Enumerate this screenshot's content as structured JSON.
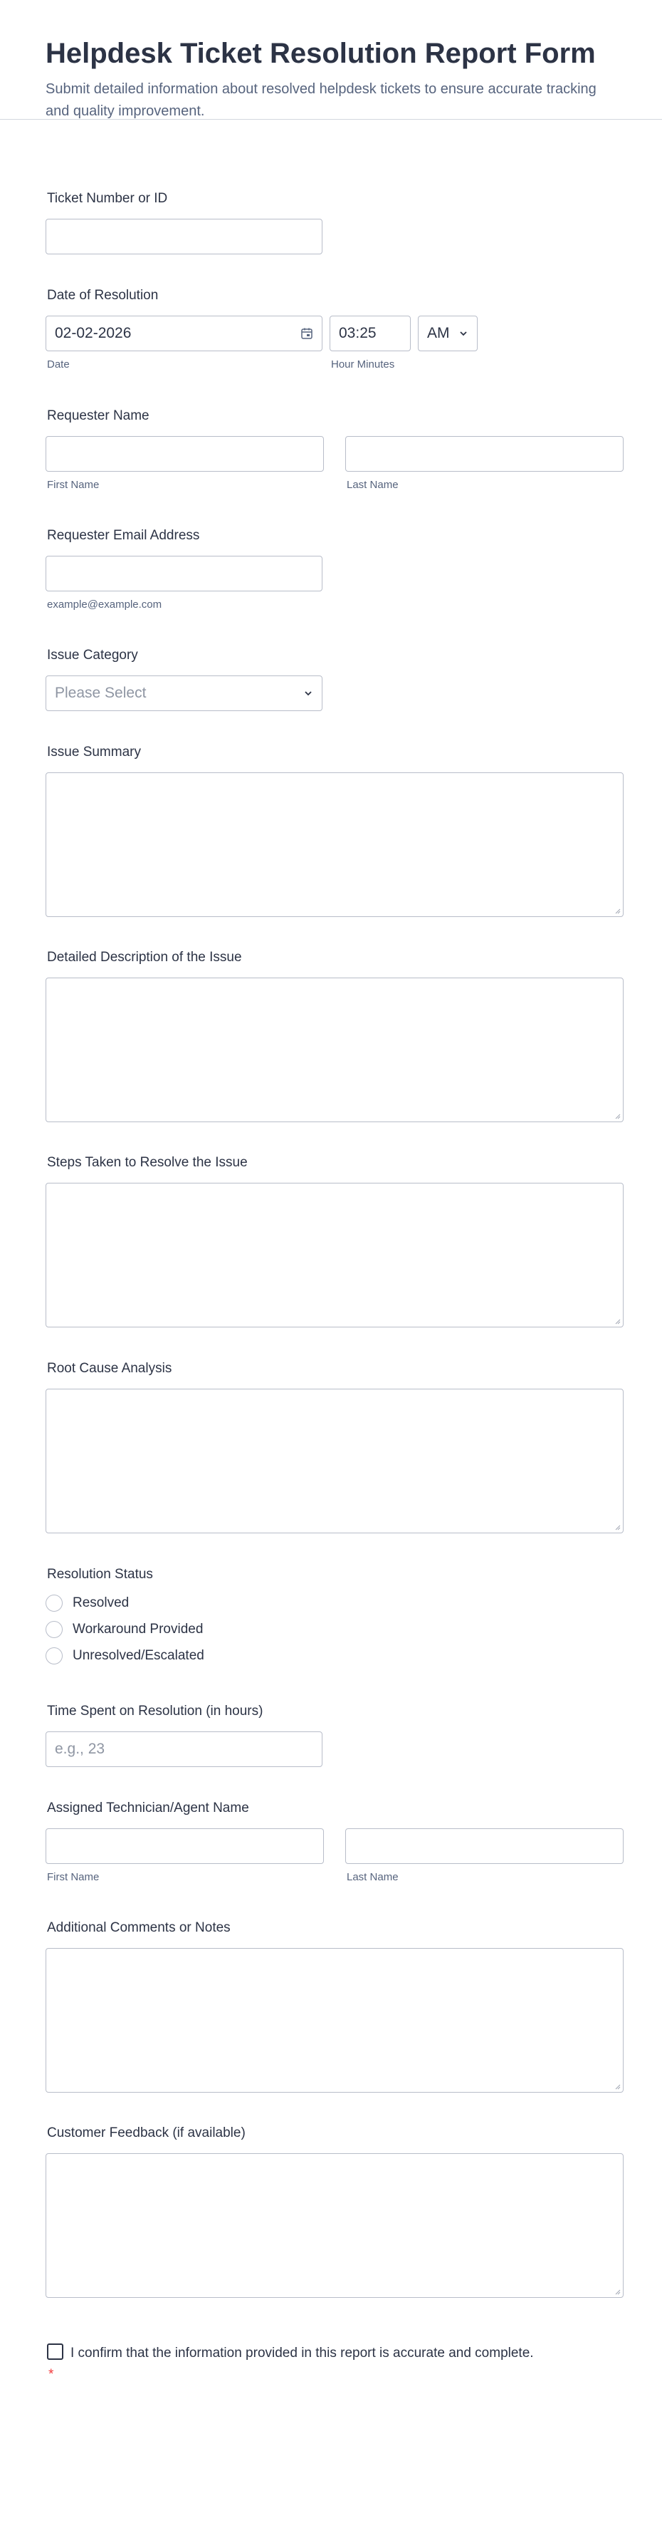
{
  "header": {
    "title": "Helpdesk Ticket Resolution Report Form",
    "subtitle": "Submit detailed information about resolved helpdesk tickets to ensure accurate tracking and quality improvement."
  },
  "ticket": {
    "label": "Ticket Number or ID",
    "value": ""
  },
  "resolution_date": {
    "label": "Date of Resolution",
    "date_value": "02-02-2026",
    "time_value": "03:25",
    "ampm_value": "AM",
    "date_sublabel": "Date",
    "time_sublabel": "Hour Minutes"
  },
  "requester_name": {
    "label": "Requester Name",
    "first_sublabel": "First Name",
    "last_sublabel": "Last Name"
  },
  "requester_email": {
    "label": "Requester Email Address",
    "sublabel": "example@example.com"
  },
  "issue_category": {
    "label": "Issue Category",
    "placeholder": "Please Select"
  },
  "issue_summary": {
    "label": "Issue Summary"
  },
  "detailed_description": {
    "label": "Detailed Description of the Issue"
  },
  "steps_taken": {
    "label": "Steps Taken to Resolve the Issue"
  },
  "root_cause": {
    "label": "Root Cause Analysis"
  },
  "resolution_status": {
    "label": "Resolution Status",
    "options": [
      "Resolved",
      "Workaround Provided",
      "Unresolved/Escalated"
    ]
  },
  "time_spent": {
    "label": "Time Spent on Resolution (in hours)",
    "placeholder": "e.g., 23"
  },
  "technician_name": {
    "label": "Assigned Technician/Agent Name",
    "first_sublabel": "First Name",
    "last_sublabel": "Last Name"
  },
  "additional_comments": {
    "label": "Additional Comments or Notes"
  },
  "customer_feedback": {
    "label": "Customer Feedback (if available)"
  },
  "confirmation": {
    "text": "I confirm that the information provided in this report is accurate and complete.",
    "required_mark": "*"
  },
  "colors": {
    "required": "#f23a3c",
    "border": "#b8bdc9",
    "sublabel": "#57647e"
  }
}
